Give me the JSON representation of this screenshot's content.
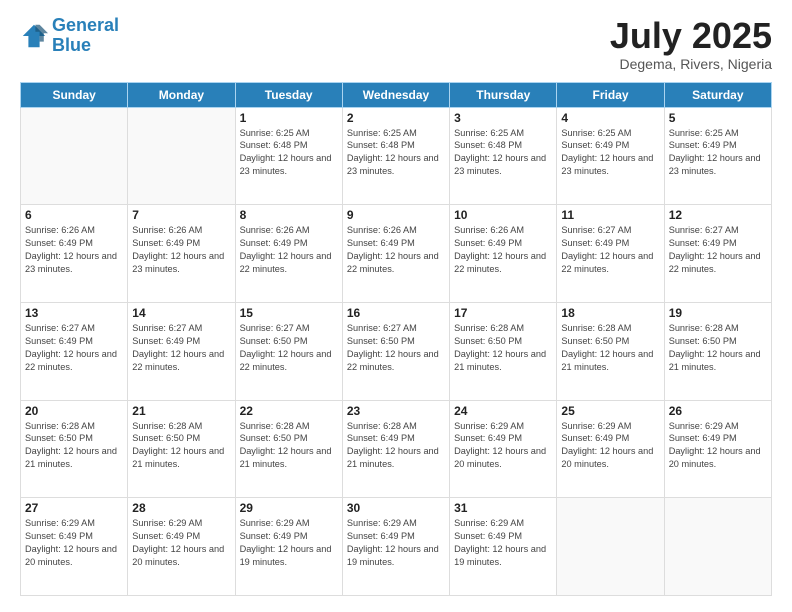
{
  "header": {
    "logo_general": "General",
    "logo_blue": "Blue",
    "month_title": "July 2025",
    "location": "Degema, Rivers, Nigeria"
  },
  "days_of_week": [
    "Sunday",
    "Monday",
    "Tuesday",
    "Wednesday",
    "Thursday",
    "Friday",
    "Saturday"
  ],
  "weeks": [
    [
      {
        "day": "",
        "detail": ""
      },
      {
        "day": "",
        "detail": ""
      },
      {
        "day": "1",
        "detail": "Sunrise: 6:25 AM\nSunset: 6:48 PM\nDaylight: 12 hours and 23 minutes."
      },
      {
        "day": "2",
        "detail": "Sunrise: 6:25 AM\nSunset: 6:48 PM\nDaylight: 12 hours and 23 minutes."
      },
      {
        "day": "3",
        "detail": "Sunrise: 6:25 AM\nSunset: 6:48 PM\nDaylight: 12 hours and 23 minutes."
      },
      {
        "day": "4",
        "detail": "Sunrise: 6:25 AM\nSunset: 6:49 PM\nDaylight: 12 hours and 23 minutes."
      },
      {
        "day": "5",
        "detail": "Sunrise: 6:25 AM\nSunset: 6:49 PM\nDaylight: 12 hours and 23 minutes."
      }
    ],
    [
      {
        "day": "6",
        "detail": "Sunrise: 6:26 AM\nSunset: 6:49 PM\nDaylight: 12 hours and 23 minutes."
      },
      {
        "day": "7",
        "detail": "Sunrise: 6:26 AM\nSunset: 6:49 PM\nDaylight: 12 hours and 23 minutes."
      },
      {
        "day": "8",
        "detail": "Sunrise: 6:26 AM\nSunset: 6:49 PM\nDaylight: 12 hours and 22 minutes."
      },
      {
        "day": "9",
        "detail": "Sunrise: 6:26 AM\nSunset: 6:49 PM\nDaylight: 12 hours and 22 minutes."
      },
      {
        "day": "10",
        "detail": "Sunrise: 6:26 AM\nSunset: 6:49 PM\nDaylight: 12 hours and 22 minutes."
      },
      {
        "day": "11",
        "detail": "Sunrise: 6:27 AM\nSunset: 6:49 PM\nDaylight: 12 hours and 22 minutes."
      },
      {
        "day": "12",
        "detail": "Sunrise: 6:27 AM\nSunset: 6:49 PM\nDaylight: 12 hours and 22 minutes."
      }
    ],
    [
      {
        "day": "13",
        "detail": "Sunrise: 6:27 AM\nSunset: 6:49 PM\nDaylight: 12 hours and 22 minutes."
      },
      {
        "day": "14",
        "detail": "Sunrise: 6:27 AM\nSunset: 6:49 PM\nDaylight: 12 hours and 22 minutes."
      },
      {
        "day": "15",
        "detail": "Sunrise: 6:27 AM\nSunset: 6:50 PM\nDaylight: 12 hours and 22 minutes."
      },
      {
        "day": "16",
        "detail": "Sunrise: 6:27 AM\nSunset: 6:50 PM\nDaylight: 12 hours and 22 minutes."
      },
      {
        "day": "17",
        "detail": "Sunrise: 6:28 AM\nSunset: 6:50 PM\nDaylight: 12 hours and 21 minutes."
      },
      {
        "day": "18",
        "detail": "Sunrise: 6:28 AM\nSunset: 6:50 PM\nDaylight: 12 hours and 21 minutes."
      },
      {
        "day": "19",
        "detail": "Sunrise: 6:28 AM\nSunset: 6:50 PM\nDaylight: 12 hours and 21 minutes."
      }
    ],
    [
      {
        "day": "20",
        "detail": "Sunrise: 6:28 AM\nSunset: 6:50 PM\nDaylight: 12 hours and 21 minutes."
      },
      {
        "day": "21",
        "detail": "Sunrise: 6:28 AM\nSunset: 6:50 PM\nDaylight: 12 hours and 21 minutes."
      },
      {
        "day": "22",
        "detail": "Sunrise: 6:28 AM\nSunset: 6:50 PM\nDaylight: 12 hours and 21 minutes."
      },
      {
        "day": "23",
        "detail": "Sunrise: 6:28 AM\nSunset: 6:49 PM\nDaylight: 12 hours and 21 minutes."
      },
      {
        "day": "24",
        "detail": "Sunrise: 6:29 AM\nSunset: 6:49 PM\nDaylight: 12 hours and 20 minutes."
      },
      {
        "day": "25",
        "detail": "Sunrise: 6:29 AM\nSunset: 6:49 PM\nDaylight: 12 hours and 20 minutes."
      },
      {
        "day": "26",
        "detail": "Sunrise: 6:29 AM\nSunset: 6:49 PM\nDaylight: 12 hours and 20 minutes."
      }
    ],
    [
      {
        "day": "27",
        "detail": "Sunrise: 6:29 AM\nSunset: 6:49 PM\nDaylight: 12 hours and 20 minutes."
      },
      {
        "day": "28",
        "detail": "Sunrise: 6:29 AM\nSunset: 6:49 PM\nDaylight: 12 hours and 20 minutes."
      },
      {
        "day": "29",
        "detail": "Sunrise: 6:29 AM\nSunset: 6:49 PM\nDaylight: 12 hours and 19 minutes."
      },
      {
        "day": "30",
        "detail": "Sunrise: 6:29 AM\nSunset: 6:49 PM\nDaylight: 12 hours and 19 minutes."
      },
      {
        "day": "31",
        "detail": "Sunrise: 6:29 AM\nSunset: 6:49 PM\nDaylight: 12 hours and 19 minutes."
      },
      {
        "day": "",
        "detail": ""
      },
      {
        "day": "",
        "detail": ""
      }
    ]
  ]
}
